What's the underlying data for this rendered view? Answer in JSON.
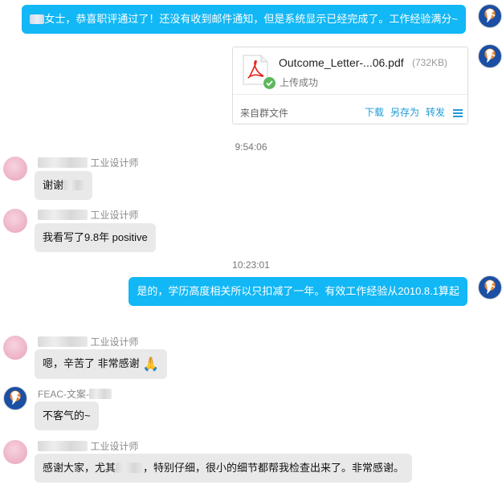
{
  "messages": {
    "m1": {
      "text_after_name": "女士，恭喜职评通过了！还没有收到邮件通知，但是系统显示已经完成了。工作经验满分~"
    },
    "file": {
      "name": "Outcome_Letter-...06.pdf",
      "size": "(732KB)",
      "status": "上传成功",
      "source": "来自群文件",
      "actions": {
        "download": "下载",
        "save_as": "另存为",
        "forward": "转发"
      }
    },
    "time1": "9:54:06",
    "m2": {
      "sender_role": "工业设计师",
      "text": "谢谢"
    },
    "m3": {
      "sender_role": "工业设计师",
      "text": "我看写了9.8年 positive"
    },
    "time2": "10:23:01",
    "m4": {
      "text": "是的，学历高度相关所以只扣减了一年。有效工作经验从2010.8.1算起"
    },
    "m5": {
      "sender_role": "工业设计师",
      "text": "嗯，辛苦了 非常感谢",
      "emoji": "🙏"
    },
    "m6": {
      "sender_prefix": "FEAC-文案-",
      "text": "不客气的~"
    },
    "m7": {
      "sender_role": "工业设计师",
      "text_before": "感谢大家，尤其",
      "text_after": "，特别仔细，很小的细节都帮我检查出来了。非常感谢。"
    }
  },
  "colors": {
    "outgoing_bubble": "#12b7f5",
    "incoming_bubble": "#e9e9e9",
    "link": "#1e9bd7",
    "pdf_red": "#e2231a",
    "success_green": "#5cb85c"
  },
  "icons": [
    "feac-avatar",
    "user-avatar",
    "pdf-icon",
    "check-circle-icon",
    "menu-icon",
    "folded-hands-emoji"
  ]
}
